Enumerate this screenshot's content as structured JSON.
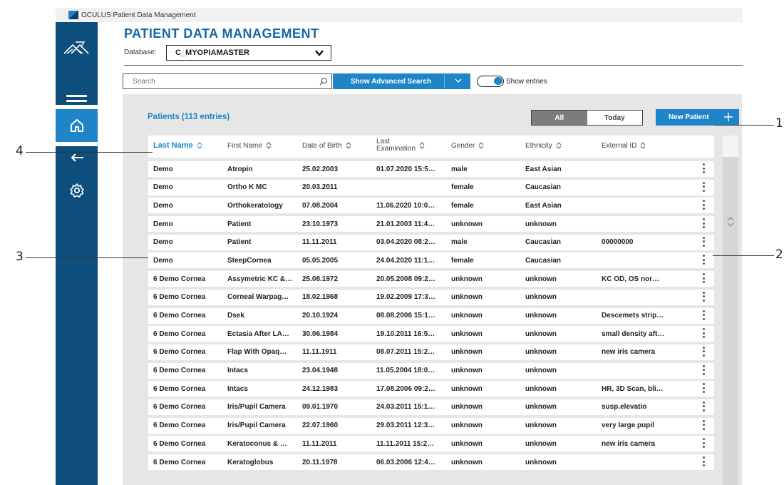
{
  "window": {
    "title": "OCULUS Patient Data Management"
  },
  "page": {
    "title": "PATIENT DATA MANAGEMENT"
  },
  "database": {
    "label": "Database:",
    "value": "C_MYOPIAMASTER"
  },
  "search": {
    "placeholder": "Search"
  },
  "advanced_search": {
    "label": "Show Advanced Search"
  },
  "toggle": {
    "label": "Show entries",
    "on": true
  },
  "patients": {
    "title": "Patients (113 entries)"
  },
  "filter": {
    "all": "All",
    "today": "Today",
    "selected": "All"
  },
  "new_patient": {
    "label": "New Patient"
  },
  "table": {
    "columns": {
      "last_name": "Last Name",
      "first_name": "First Name",
      "dob": "Date of Birth",
      "last_exam_1": "Last",
      "last_exam_2": "Examination",
      "gender": "Gender",
      "ethnicity": "Ethnicity",
      "external_id": "External ID"
    },
    "rows": [
      {
        "last": "Demo",
        "first": "Atropin",
        "dob": "25.02.2003",
        "exam": "01.07.2020 15:5…",
        "gender": "male",
        "ethnicity": "East Asian",
        "ext": ""
      },
      {
        "last": "Demo",
        "first": "Ortho K MC",
        "dob": "20.03.2011",
        "exam": "",
        "gender": "female",
        "ethnicity": "Caucasian",
        "ext": ""
      },
      {
        "last": "Demo",
        "first": "Orthokeratology",
        "dob": "07.08.2004",
        "exam": "11.06.2020 10:0…",
        "gender": "female",
        "ethnicity": "East Asian",
        "ext": ""
      },
      {
        "last": "Demo",
        "first": "Patient",
        "dob": "23.10.1973",
        "exam": "21.01.2003 11:4…",
        "gender": "unknown",
        "ethnicity": "unknown",
        "ext": ""
      },
      {
        "last": "Demo",
        "first": "Patient",
        "dob": "11.11.2011",
        "exam": "03.04.2020 08:2…",
        "gender": "male",
        "ethnicity": "Caucasian",
        "ext": "00000000"
      },
      {
        "last": "Demo",
        "first": "SteepCornea",
        "dob": "05.05.2005",
        "exam": "24.04.2020 11:1…",
        "gender": "female",
        "ethnicity": "Caucasian",
        "ext": ""
      },
      {
        "last": "6 Demo Cornea",
        "first": "Assymetric KC &…",
        "dob": "25.08.1972",
        "exam": "20.05.2008 09:2…",
        "gender": "unknown",
        "ethnicity": "unknown",
        "ext": "KC OD, OS nor…"
      },
      {
        "last": "6 Demo Cornea",
        "first": "Corneal Warpag…",
        "dob": "18.02.1968",
        "exam": "19.02.2009 17:3…",
        "gender": "unknown",
        "ethnicity": "unknown",
        "ext": ""
      },
      {
        "last": "6 Demo Cornea",
        "first": "Dsek",
        "dob": "20.10.1924",
        "exam": "08.08.2006 15:1…",
        "gender": "unknown",
        "ethnicity": "unknown",
        "ext": "Descemets strip…"
      },
      {
        "last": "6 Demo Cornea",
        "first": "Ectasia After LA…",
        "dob": "30.06.1984",
        "exam": "19.10.2011 16:5…",
        "gender": "unknown",
        "ethnicity": "unknown",
        "ext": "small density aft…"
      },
      {
        "last": "6 Demo Cornea",
        "first": "Flap With Opaq…",
        "dob": "11.11.1911",
        "exam": "08.07.2011 15:2…",
        "gender": "unknown",
        "ethnicity": "unknown",
        "ext": "new iris camera"
      },
      {
        "last": "6 Demo Cornea",
        "first": "Intacs",
        "dob": "23.04.1948",
        "exam": "11.05.2004 18:0…",
        "gender": "unknown",
        "ethnicity": "unknown",
        "ext": ""
      },
      {
        "last": "6 Demo Cornea",
        "first": "Intacs",
        "dob": "24.12.1983",
        "exam": "17.08.2006 09:2…",
        "gender": "unknown",
        "ethnicity": "unknown",
        "ext": "HR, 3D Scan, bli…"
      },
      {
        "last": "6 Demo Cornea",
        "first": "Iris/Pupil Camera",
        "dob": "09.01.1970",
        "exam": "24.03.2011 15:1…",
        "gender": "unknown",
        "ethnicity": "unknown",
        "ext": "susp.elevatio"
      },
      {
        "last": "6 Demo Cornea",
        "first": "Iris/Pupil Camera",
        "dob": "22.07.1960",
        "exam": "29.03.2011 12:3…",
        "gender": "unknown",
        "ethnicity": "unknown",
        "ext": "very large pupil"
      },
      {
        "last": "6 Demo Cornea",
        "first": "Keratoconus & …",
        "dob": "11.11.2011",
        "exam": "11.11.2011 15:2…",
        "gender": "unknown",
        "ethnicity": "unknown",
        "ext": "new iris camera"
      },
      {
        "last": "6 Demo Cornea",
        "first": "Keratoglobus",
        "dob": "20.11.1978",
        "exam": "06.03.2006 12:4…",
        "gender": "unknown",
        "ethnicity": "unknown",
        "ext": ""
      }
    ]
  },
  "callouts": [
    "1",
    "2",
    "3",
    "4"
  ],
  "icons": [
    "oculus-logo-icon",
    "menu-icon",
    "home-icon",
    "back-icon",
    "gear-icon",
    "chevron-down-icon",
    "search-icon",
    "plus-icon",
    "sort-icon",
    "more-vertical-icon",
    "scroll-arrows-icon"
  ],
  "colors": {
    "sidebar": "#0d4e7c",
    "accent": "#1d85c8",
    "title": "#1468a6",
    "panel": "#e6e6e6"
  }
}
